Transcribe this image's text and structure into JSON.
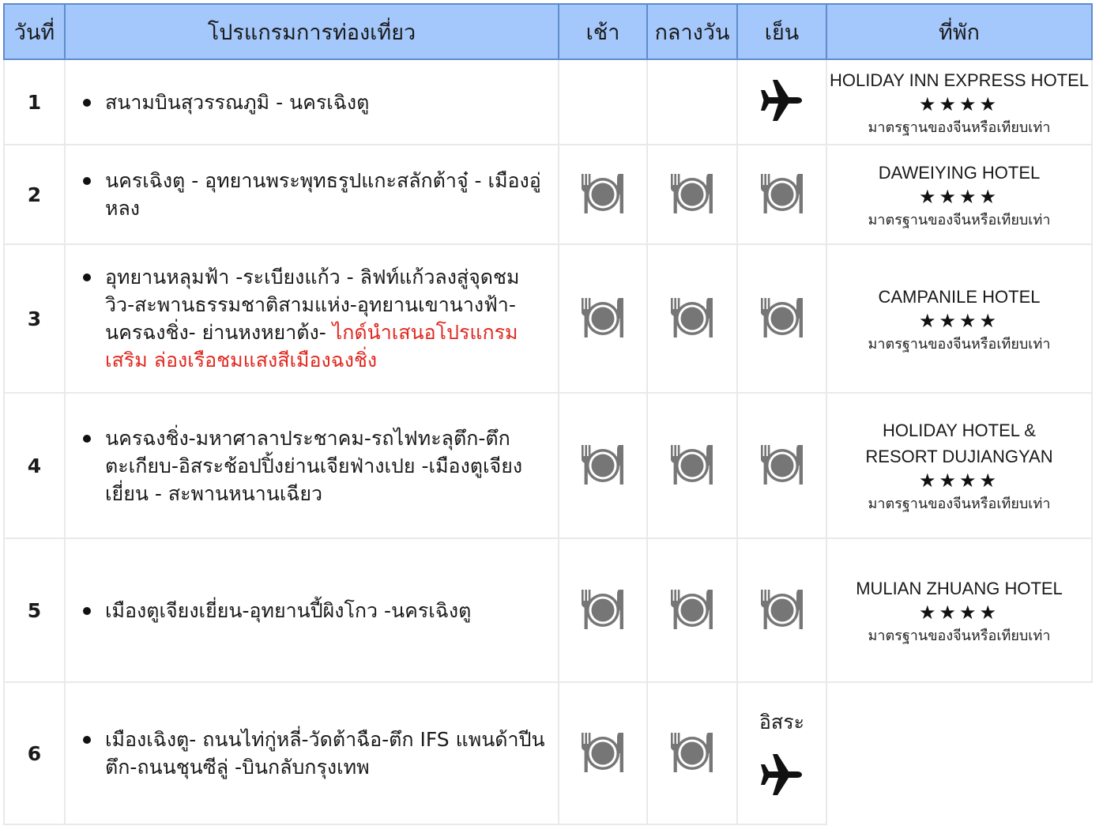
{
  "headers": [
    "วันที่",
    "โปรแกรมการท่องเที่ยว",
    "เช้า",
    "กลางวัน",
    "เย็น",
    "ที่พัก"
  ],
  "days": [
    {
      "day": "1",
      "program": [
        "สนามบินสุวรรณภูมิ - นครเฉิงตู"
      ],
      "program_red": "",
      "meals": [
        "",
        "",
        "plane"
      ],
      "hotel": {
        "name": "HOLIDAY INN EXPRESS  HOTEL",
        "stars": "★★★★",
        "standard": "มาตรฐานของจีนหรือเทียบเท่า"
      }
    },
    {
      "day": "2",
      "program": [
        "นครเฉิงตู - อุทยานพระพุทธรูปแกะสลักต้าจู๋ - เมืองอู่หลง"
      ],
      "program_red": "",
      "meals": [
        "meal",
        "meal",
        "meal"
      ],
      "hotel": {
        "name": "DAWEIYING HOTEL",
        "stars": "★★★★",
        "standard": "มาตรฐานของจีนหรือเทียบเท่า"
      }
    },
    {
      "day": "3",
      "program": [
        "อุทยานหลุมฟ้า -ระเบียงแก้ว - ลิฟท์แก้วลงสู่จุดชมวิว-สะพานธรรมชาติสามแห่ง-อุทยานเขานางฟ้า-นครฉงชิ่ง- ย่านหงหยาต้ง- "
      ],
      "program_red": "ไกด์นำเสนอโปรแกรมเสริม ล่องเรือชมแสงสีเมืองฉงชิ่ง",
      "meals": [
        "meal",
        "meal",
        "meal"
      ],
      "hotel": {
        "name": "CAMPANILE HOTEL",
        "stars": "★★★★",
        "standard": "มาตรฐานของจีนหรือเทียบเท่า"
      }
    },
    {
      "day": "4",
      "program": [
        "นครฉงชิ่ง-มหาศาลาประชาคม-รถไฟทะลุตึก-ตึกตะเกียบ-อิสระช้อปปิ้งย่านเจียฟ่างเปย -เมืองตูเจียงเยี่ยน - สะพานหนานเฉียว"
      ],
      "program_red": "",
      "meals": [
        "meal",
        "meal",
        "meal"
      ],
      "hotel": {
        "name": "HOLIDAY HOTEL & RESORT DUJIANGYAN",
        "stars": "★★★★",
        "standard": "มาตรฐานของจีนหรือเทียบเท่า"
      }
    },
    {
      "day": "5",
      "program": [
        "เมืองตูเจียงเยี่ยน-อุทยานปี้ผิงโกว -นครเฉิงตู"
      ],
      "program_red": "",
      "meals": [
        "meal",
        "meal",
        "meal"
      ],
      "hotel": {
        "name": "MULIAN ZHUANG HOTEL",
        "stars": "★★★★",
        "standard": "มาตรฐานของจีนหรือเทียบเท่า"
      }
    },
    {
      "day": "6",
      "program": [
        "เมืองเฉิงตู- ถนนไท่กู่หลี่-วัดต้าฉือ-ตึก IFS แพนด้าปีนตึก-ถนนชุนซีลู่ -บินกลับกรุงเทพ"
      ],
      "program_red": "",
      "meals": [
        "meal",
        "meal",
        "free-plane"
      ],
      "free_label": "อิสระ",
      "hotel": {
        "name": "",
        "stars": "",
        "standard": ""
      }
    }
  ],
  "icons": {
    "meal": "plate-fork-knife-icon",
    "plane": "airplane-icon"
  },
  "colors": {
    "header_bg": "#a4c8fb",
    "header_border": "#5f8ccd",
    "icon_gray": "#767676",
    "red_text": "#e0281f"
  }
}
